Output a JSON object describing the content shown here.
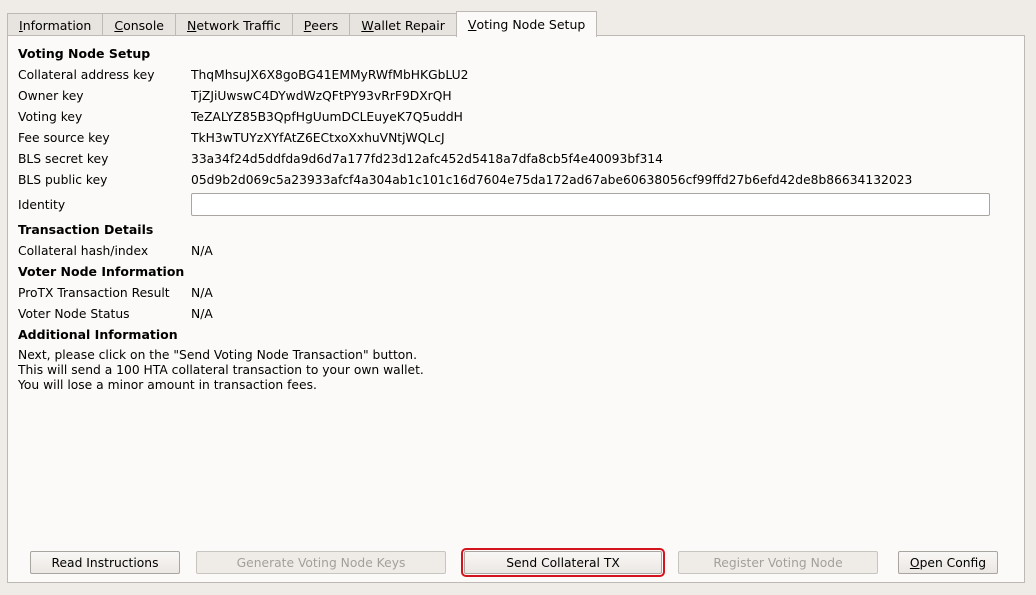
{
  "tabs": [
    {
      "label": "Information",
      "mnemonic": "I",
      "rest": "nformation"
    },
    {
      "label": "Console",
      "mnemonic": "C",
      "rest": "onsole"
    },
    {
      "label": "Network Traffic",
      "mnemonic": "N",
      "rest": "etwork Traffic"
    },
    {
      "label": "Peers",
      "mnemonic": "P",
      "rest": "eers"
    },
    {
      "label": "Wallet Repair",
      "mnemonic": "W",
      "rest": "allet Repair"
    },
    {
      "label": "Voting Node Setup",
      "mnemonic": "V",
      "rest": "oting Node Setup"
    }
  ],
  "setup": {
    "heading": "Voting Node Setup",
    "collateral_address_label": "Collateral address key",
    "collateral_address_value": "ThqMhsuJX6X8goBG41EMMyRWfMbHKGbLU2",
    "owner_key_label": "Owner key",
    "owner_key_value": "TjZJiUwswC4DYwdWzQFtPY93vRrF9DXrQH",
    "voting_key_label": "Voting key",
    "voting_key_value": "TeZALYZ85B3QpfHgUumDCLEuyeK7Q5uddH",
    "fee_source_label": "Fee source key",
    "fee_source_value": "TkH3wTUYzXYfAtZ6ECtxoXxhuVNtjWQLcJ",
    "bls_secret_label": "BLS secret key",
    "bls_secret_value": "33a34f24d5ddfda9d6d7a177fd23d12afc452d5418a7dfa8cb5f4e40093bf314",
    "bls_public_label": "BLS public key",
    "bls_public_value": "05d9b2d069c5a23933afcf4a304ab1c101c16d7604e75da172ad67abe60638056cf99ffd27b6efd42de8b86634132023",
    "identity_label": "Identity",
    "identity_value": ""
  },
  "transaction": {
    "heading": "Transaction Details",
    "hash_label": "Collateral hash/index",
    "hash_value": "N/A"
  },
  "voter": {
    "heading": "Voter Node Information",
    "protx_label": "ProTX Transaction Result",
    "protx_value": "N/A",
    "status_label": "Voter Node Status",
    "status_value": "N/A"
  },
  "additional": {
    "heading": "Additional Information",
    "line1": "Next, please click on the \"Send Voting Node Transaction\" button.",
    "line2": "This will send a 100 HTA collateral transaction to your own wallet.",
    "line3": "You will lose a minor amount in transaction fees."
  },
  "buttons": {
    "read_instructions": "Read Instructions",
    "generate_keys": "Generate Voting Node Keys",
    "send_collateral": "Send Collateral TX",
    "register_node": "Register Voting Node",
    "open_config_mnemonic": "O",
    "open_config_rest": "pen Config"
  }
}
